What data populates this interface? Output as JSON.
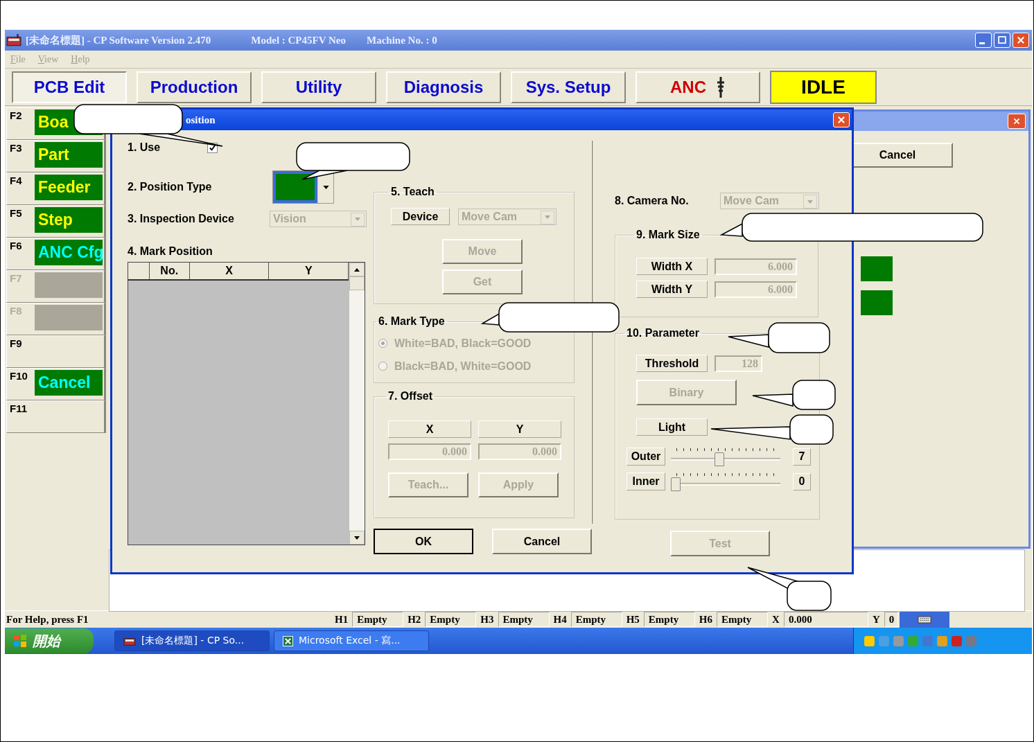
{
  "window": {
    "title": "[未命名標題] - CP Software Version 2.470",
    "model": "Model : CP45FV Neo",
    "machine": "Machine No. : 0"
  },
  "menu": [
    "File",
    "View",
    "Help"
  ],
  "main_tabs": [
    {
      "label": "PCB Edit",
      "selected": true,
      "kind": "tab"
    },
    {
      "label": "Production",
      "selected": false,
      "kind": "tab"
    },
    {
      "label": "Utility",
      "selected": false,
      "kind": "tab"
    },
    {
      "label": "Diagnosis",
      "selected": false,
      "kind": "tab"
    },
    {
      "label": "Sys. Setup",
      "selected": false,
      "kind": "tab"
    },
    {
      "label": "ANC",
      "selected": false,
      "kind": "anc"
    }
  ],
  "status_indicator": "IDLE",
  "function_keys": [
    {
      "key": "F2",
      "kind": "button",
      "label": "Boa",
      "color": "#ffff00",
      "disabled": false
    },
    {
      "key": "F3",
      "kind": "button",
      "label": "Part",
      "color": "#ffff00",
      "disabled": false
    },
    {
      "key": "F4",
      "kind": "button",
      "label": "Feeder",
      "color": "#ffff00",
      "disabled": false
    },
    {
      "key": "F5",
      "kind": "button",
      "label": "Step",
      "color": "#ffff00",
      "disabled": false
    },
    {
      "key": "F6",
      "kind": "button",
      "label": "ANC Cfg",
      "color": "#00ffff",
      "disabled": false
    },
    {
      "key": "F7",
      "kind": "button",
      "disabled": true
    },
    {
      "key": "F8",
      "kind": "button",
      "disabled": true
    },
    {
      "key": "F9",
      "kind": "none",
      "disabled": false
    },
    {
      "key": "F10",
      "kind": "button",
      "label": "Cancel",
      "color": "#00ffff",
      "disabled": false
    },
    {
      "key": "F11",
      "kind": "none",
      "disabled": false
    }
  ],
  "back_dialog": {
    "button": "Cancel"
  },
  "dialog": {
    "title": "osition",
    "use": {
      "label": "1. Use",
      "checked": true
    },
    "position_type": {
      "label": "2. Position Type"
    },
    "inspection_device": {
      "label": "3. Inspection Device",
      "value": "Vision"
    },
    "mark_position": {
      "label": "4. Mark Position",
      "columns": [
        "No.",
        "X",
        "Y"
      ]
    },
    "teach": {
      "label": "5. Teach",
      "device_label": "Device",
      "device_value": "Move Cam",
      "buttons": [
        {
          "label": "Move",
          "disabled": true
        },
        {
          "label": "Get",
          "disabled": true
        }
      ]
    },
    "mark_type": {
      "label": "6. Mark Type",
      "options": [
        {
          "label": "White=BAD, Black=GOOD",
          "selected": true
        },
        {
          "label": "Black=BAD, White=GOOD",
          "selected": false
        }
      ]
    },
    "offset": {
      "label": "7. Offset",
      "columns": [
        "X",
        "Y"
      ],
      "values": [
        "0.000",
        "0.000"
      ],
      "buttons": [
        {
          "label": "Teach...",
          "disabled": true
        },
        {
          "label": "Apply",
          "disabled": true
        }
      ]
    },
    "buttons": [
      {
        "label": "OK",
        "disabled": false
      },
      {
        "label": "Cancel",
        "disabled": false
      }
    ],
    "camera": {
      "label": "8. Camera No.",
      "value": "Move Cam"
    },
    "mark_size": {
      "label": "9. Mark Size",
      "rows": [
        {
          "label": "Width X",
          "value": "6.000"
        },
        {
          "label": "Width Y",
          "value": "6.000"
        }
      ]
    },
    "parameter": {
      "label": "10. Parameter",
      "threshold_label": "Threshold",
      "threshold": "128",
      "binary": {
        "label": "Binary",
        "disabled": true
      },
      "light": "Light",
      "sliders": [
        {
          "label": "Outer",
          "level": 0.45,
          "reading": "7"
        },
        {
          "label": "Inner",
          "level": 0,
          "reading": "0"
        }
      ]
    },
    "test": {
      "label": "Test",
      "disabled": true
    }
  },
  "status_bar": {
    "help": "For Help, press F1",
    "slots": [
      {
        "key": "H1",
        "value": "Empty"
      },
      {
        "key": "H2",
        "value": "Empty"
      },
      {
        "key": "H3",
        "value": "Empty"
      },
      {
        "key": "H4",
        "value": "Empty"
      },
      {
        "key": "H5",
        "value": "Empty"
      },
      {
        "key": "H6",
        "value": "Empty"
      }
    ],
    "x_label": "X",
    "x_value": "0.000",
    "y_label": "Y",
    "y_value": "0"
  },
  "taskbar": {
    "start": "開始",
    "tasks": [
      "[未命名標題] - CP So...",
      "Microsoft Excel - 寫..."
    ]
  }
}
